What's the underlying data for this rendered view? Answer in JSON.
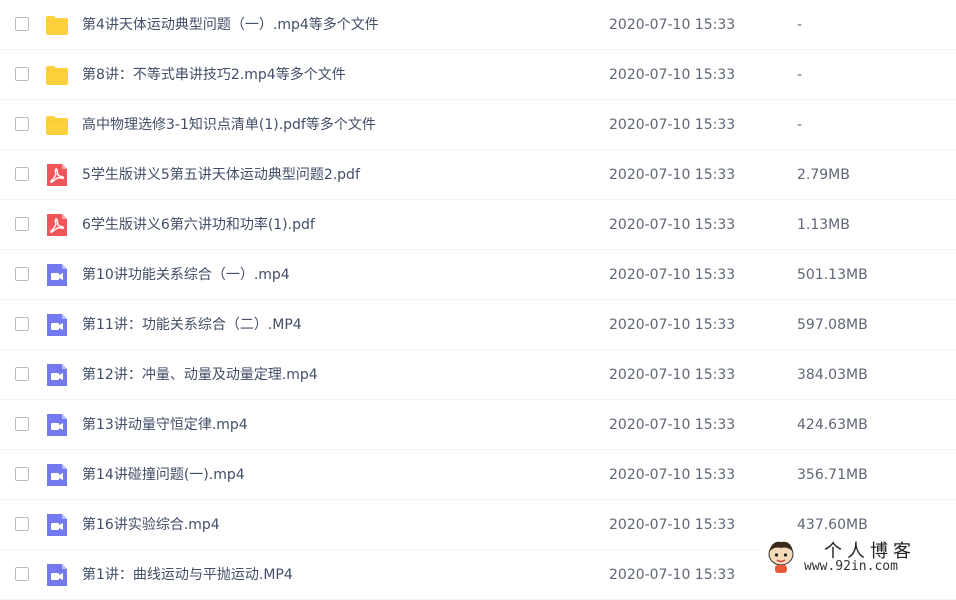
{
  "files": [
    {
      "type": "folder",
      "name": "第4讲天体运动典型问题（一）.mp4等多个文件",
      "time": "2020-07-10 15:33",
      "size": "-"
    },
    {
      "type": "folder",
      "name": "第8讲：不等式串讲技巧2.mp4等多个文件",
      "time": "2020-07-10 15:33",
      "size": "-"
    },
    {
      "type": "folder",
      "name": "高中物理选修3-1知识点清单(1).pdf等多个文件",
      "time": "2020-07-10 15:33",
      "size": "-"
    },
    {
      "type": "pdf",
      "name": "5学生版讲义5第五讲天体运动典型问题2.pdf",
      "time": "2020-07-10 15:33",
      "size": "2.79MB"
    },
    {
      "type": "pdf",
      "name": "6学生版讲义6第六讲功和功率(1).pdf",
      "time": "2020-07-10 15:33",
      "size": "1.13MB"
    },
    {
      "type": "video",
      "name": "第10讲功能关系综合（一）.mp4",
      "time": "2020-07-10 15:33",
      "size": "501.13MB"
    },
    {
      "type": "video",
      "name": "第11讲：功能关系综合（二）.MP4",
      "time": "2020-07-10 15:33",
      "size": "597.08MB"
    },
    {
      "type": "video",
      "name": "第12讲：冲量、动量及动量定理.mp4",
      "time": "2020-07-10 15:33",
      "size": "384.03MB"
    },
    {
      "type": "video",
      "name": "第13讲动量守恒定律.mp4",
      "time": "2020-07-10 15:33",
      "size": "424.63MB"
    },
    {
      "type": "video",
      "name": "第14讲碰撞问题(一).mp4",
      "time": "2020-07-10 15:33",
      "size": "356.71MB"
    },
    {
      "type": "video",
      "name": "第16讲实验综合.mp4",
      "time": "2020-07-10 15:33",
      "size": "437.60MB"
    },
    {
      "type": "video",
      "name": "第1讲：曲线运动与平抛运动.MP4",
      "time": "2020-07-10 15:33",
      "size": ""
    }
  ],
  "colors": {
    "folder": "#fdd13c",
    "pdf": "#f0555a",
    "video": "#7479f0"
  },
  "watermark": {
    "title": "个人博客",
    "url": "www.92in.com"
  }
}
